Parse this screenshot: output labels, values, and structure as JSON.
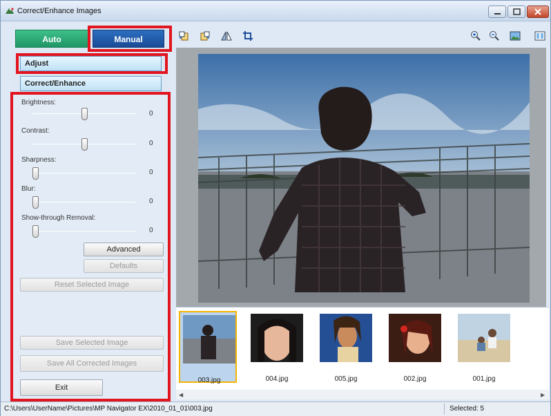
{
  "window": {
    "title": "Correct/Enhance Images"
  },
  "tabs": {
    "auto": "Auto",
    "manual": "Manual"
  },
  "sections": {
    "adjust": "Adjust",
    "correct_enhance": "Correct/Enhance"
  },
  "controls": [
    {
      "label": "Brightness:",
      "value": "0",
      "level": 0.5
    },
    {
      "label": "Contrast:",
      "value": "0",
      "level": 0.5
    },
    {
      "label": "Sharpness:",
      "value": "0",
      "level": 0.0
    },
    {
      "label": "Blur:",
      "value": "0",
      "level": 0.0
    },
    {
      "label": "Show-through Removal:",
      "value": "0",
      "level": 0.0
    }
  ],
  "buttons": {
    "advanced": "Advanced",
    "defaults": "Defaults",
    "reset_selected": "Reset Selected Image",
    "save_selected": "Save Selected Image",
    "save_all": "Save All Corrected Images",
    "exit": "Exit"
  },
  "toolbar": {
    "left": [
      "rotate-left-icon",
      "rotate-right-icon",
      "flip-icon",
      "crop-icon"
    ],
    "right": [
      "zoom-in-icon",
      "zoom-out-icon",
      "full-image-icon",
      "compare-icon"
    ]
  },
  "thumbnails": [
    {
      "name": "003.jpg",
      "selected": true
    },
    {
      "name": "004.jpg",
      "selected": false
    },
    {
      "name": "005.jpg",
      "selected": false
    },
    {
      "name": "002.jpg",
      "selected": false
    },
    {
      "name": "001.jpg",
      "selected": false
    }
  ],
  "status": {
    "path": "C:\\Users\\UserName\\Pictures\\MP Navigator EX\\2010_01_01\\003.jpg",
    "selected": "Selected: 5"
  },
  "colors": {
    "highlight": "#e2141f",
    "manual_tab": "#1a4b96",
    "auto_tab": "#1f9566",
    "selection": "#f5b400"
  }
}
